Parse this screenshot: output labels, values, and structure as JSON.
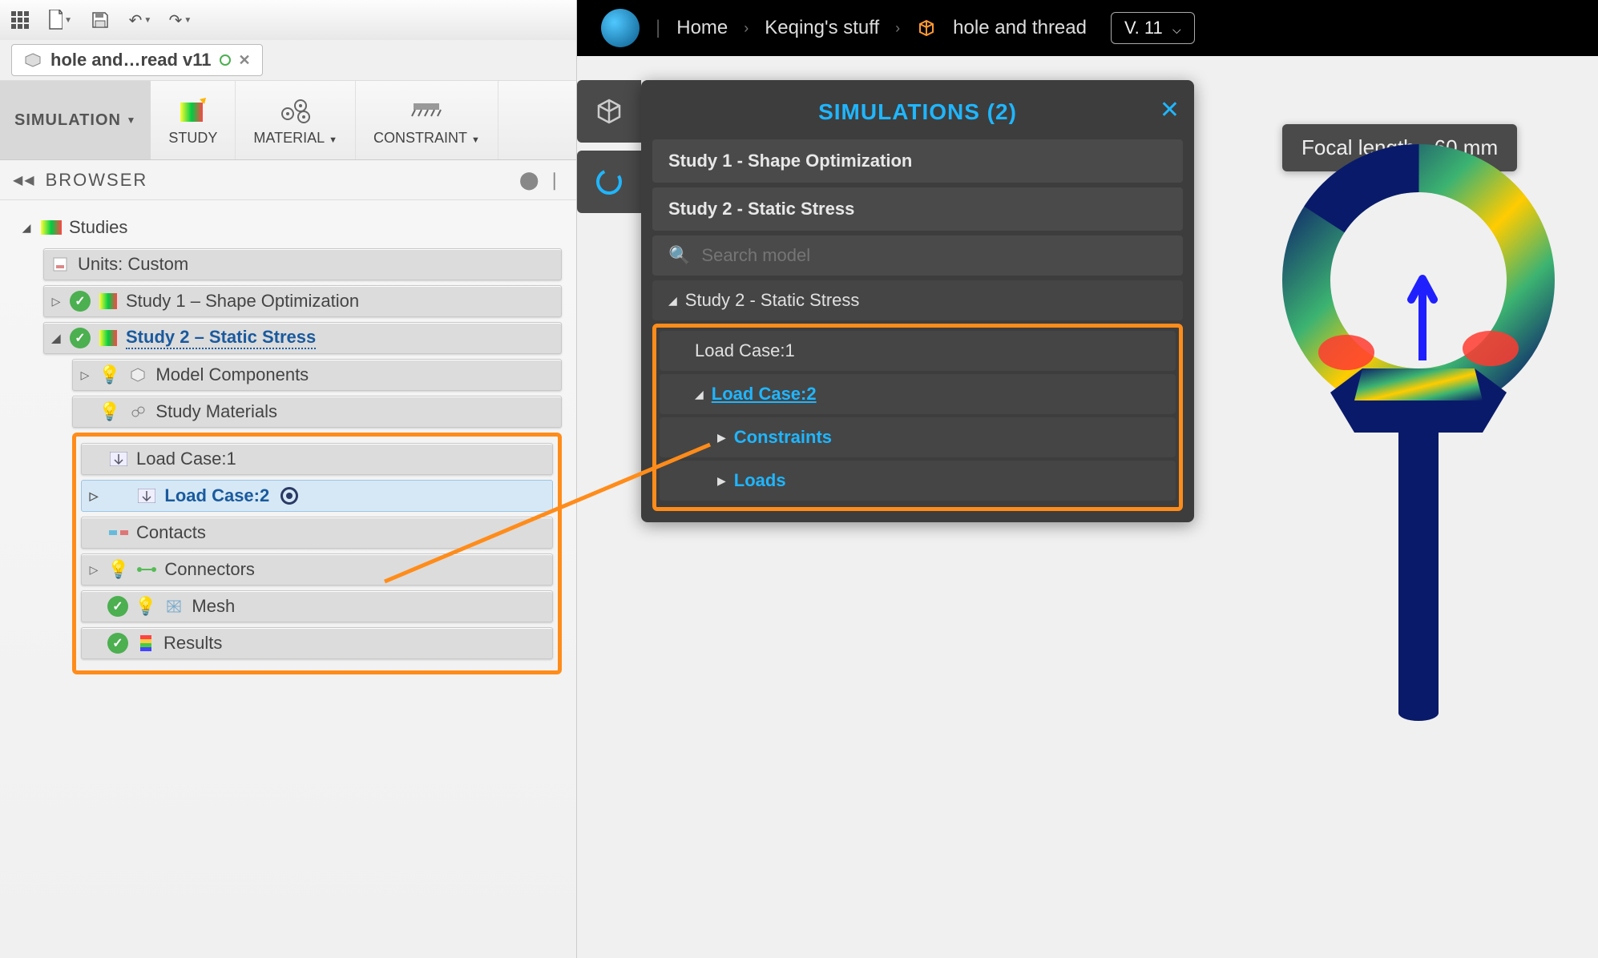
{
  "left": {
    "toolbar_icons": [
      "grid-icon",
      "new-file-icon",
      "save-icon",
      "undo-icon",
      "redo-icon"
    ],
    "doc_tab": "hole and…read v11",
    "ribbon": {
      "simulation": "SIMULATION",
      "study": "STUDY",
      "material": "MATERIAL",
      "constraint": "CONSTRAINT"
    },
    "browser_label": "BROWSER",
    "tree": {
      "studies": "Studies",
      "units": "Units: Custom",
      "study1": "Study 1 – Shape Optimization",
      "study2": "Study 2 – Static Stress",
      "model_components": "Model Components",
      "study_materials": "Study Materials",
      "load_case_1": "Load Case:1",
      "load_case_2": "Load Case:2",
      "contacts": "Contacts",
      "connectors": "Connectors",
      "mesh": "Mesh",
      "results": "Results"
    }
  },
  "right": {
    "breadcrumb": {
      "home": "Home",
      "folder": "Keqing's stuff",
      "doc": "hole and thread",
      "version": "V. 11"
    },
    "sim_panel": {
      "title": "SIMULATIONS (2)",
      "study1": "Study 1 - Shape Optimization",
      "study2": "Study 2 - Static Stress",
      "search_placeholder": "Search model",
      "tree_study2": "Study 2 - Static Stress",
      "lc1": "Load Case:1",
      "lc2": "Load Case:2",
      "constraints": "Constraints",
      "loads": "Loads"
    },
    "focal": {
      "label": "Focal length",
      "value": "60 mm"
    }
  },
  "colors": {
    "accent_blue": "#1fb6ff",
    "highlight_orange": "#ff8c1a",
    "fusion_blue": "#1a5a9e"
  }
}
